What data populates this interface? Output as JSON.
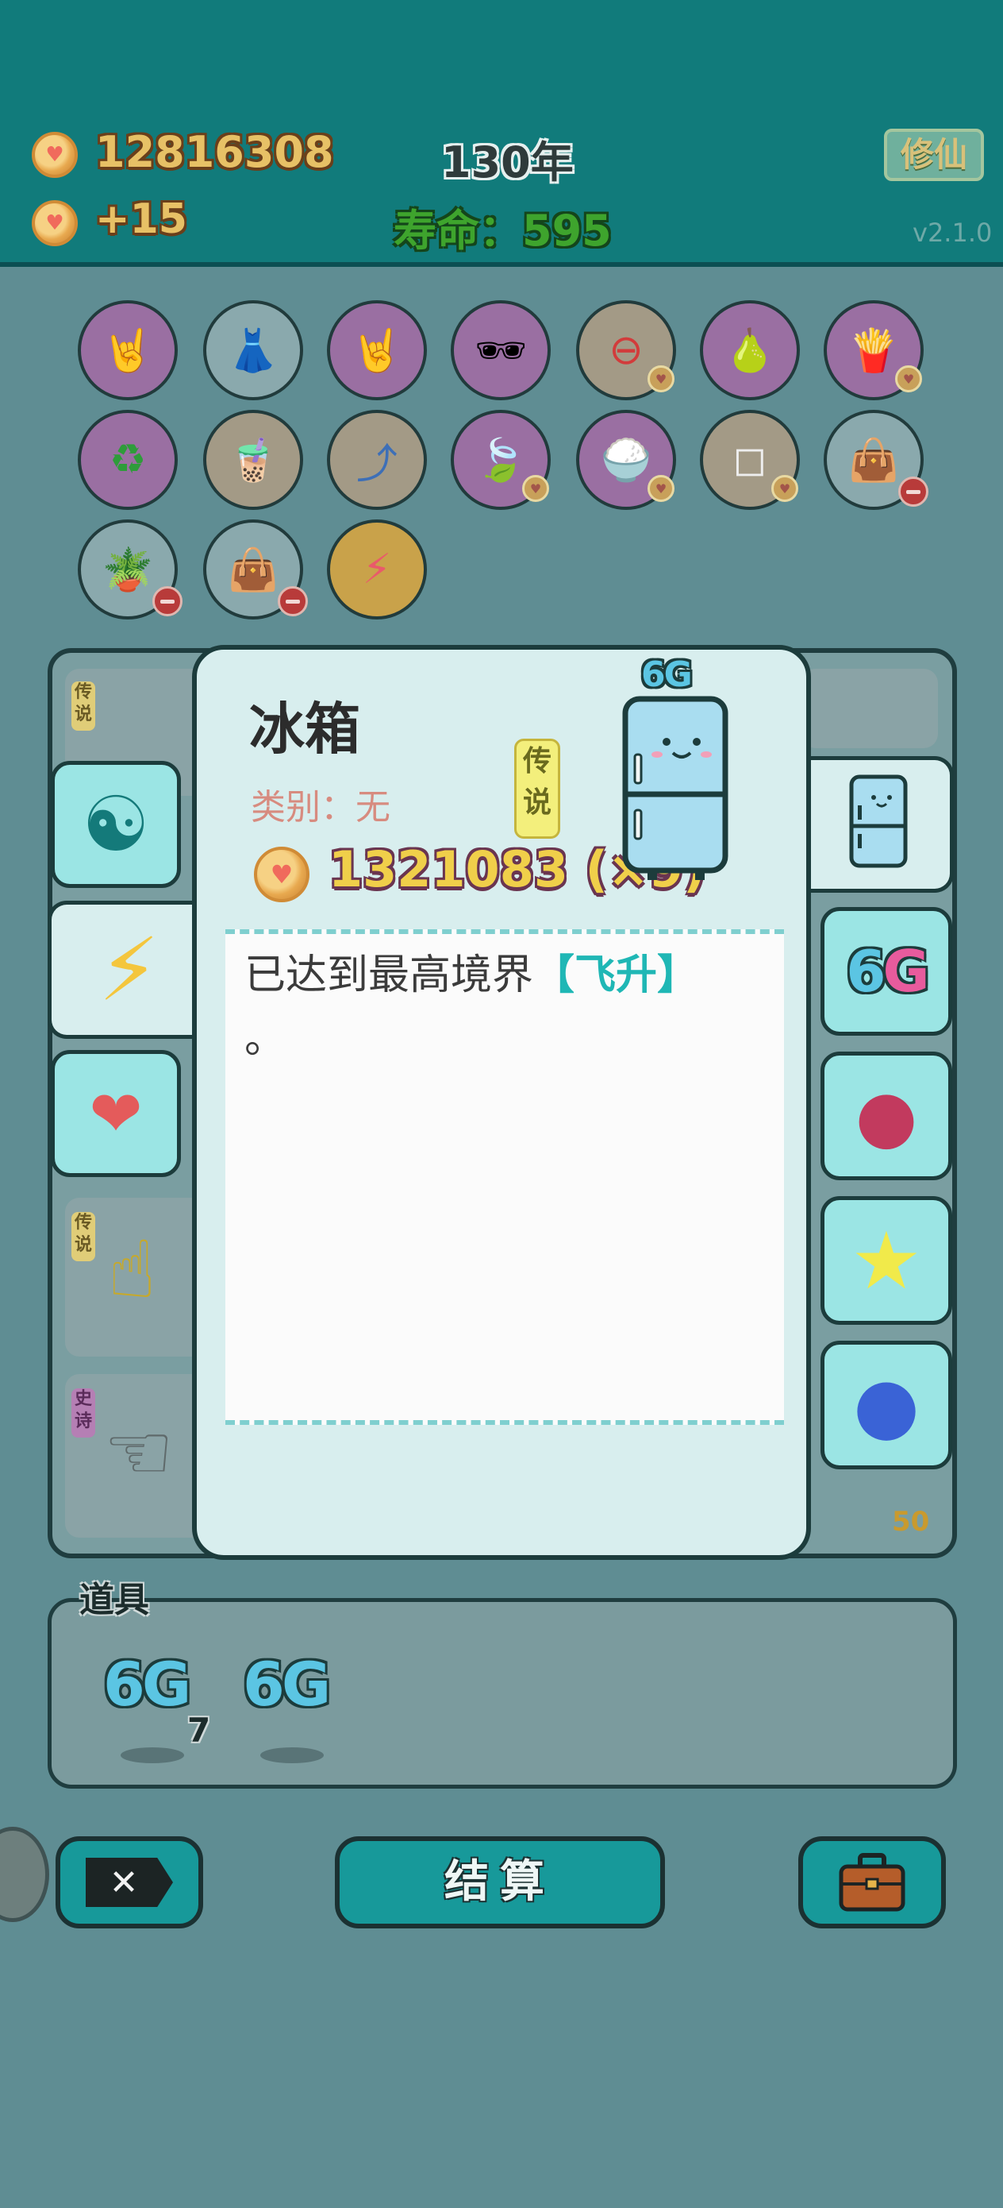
{
  "hud": {
    "coins": "12816308",
    "income": "+15",
    "year": "130年",
    "lifespan": "寿命：595",
    "cultivate_button": "修仙",
    "version": "v2.1.0"
  },
  "popup": {
    "tier_label": "6G",
    "item_name": "冰箱",
    "category": "类别：无",
    "rarity_tag": "传说",
    "price": "1321083 (×9)",
    "description_prefix": "已达到最高境界",
    "description_highlight": "【飞升】",
    "description_suffix": "。"
  },
  "tabs": {
    "right_6g": "6G"
  },
  "cards": {
    "tag_1": "传说",
    "tag_2": "传说",
    "tag_3": "史诗",
    "count": "50"
  },
  "items_bar": {
    "label": "道具",
    "item_1": "6G",
    "item_1_count": "7",
    "item_2": "6G"
  },
  "buttons": {
    "settle": "结算"
  }
}
